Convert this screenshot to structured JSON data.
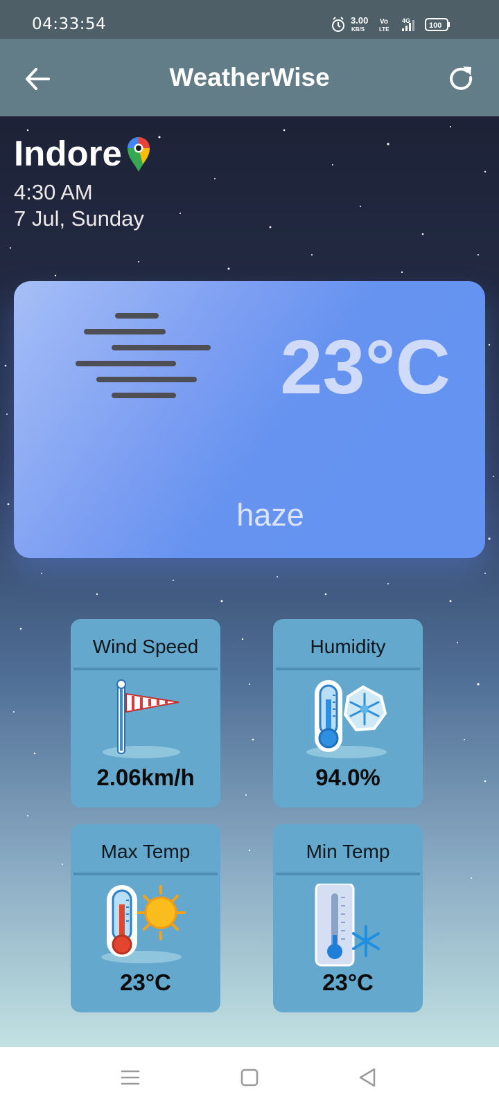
{
  "status_bar": {
    "time": "04:33:54",
    "net_speed_value": "3.00",
    "net_speed_unit": "KB/S",
    "volte_top": "Vo",
    "volte_bottom": "LTE",
    "network": "4G",
    "battery": "100",
    "icons": [
      "alarm-icon",
      "volte-icon",
      "signal-icon",
      "battery-icon"
    ]
  },
  "app_bar": {
    "title": "WeatherWise",
    "back_icon": "arrow-left-icon",
    "refresh_icon": "refresh-icon"
  },
  "location": {
    "city": "Indore",
    "pin_icon": "map-pin-icon",
    "time": "4:30 AM",
    "date": "7 Jul, Sunday"
  },
  "current": {
    "temperature": "23°C",
    "condition": "haze",
    "icon": "haze-icon"
  },
  "stats": [
    {
      "title": "Wind Speed",
      "value": "2.06km/h",
      "icon": "windsock-icon"
    },
    {
      "title": "Humidity",
      "value": "94.0%",
      "icon": "thermometer-snowflake-icon"
    },
    {
      "title": "Max Temp",
      "value": "23°C",
      "icon": "thermometer-sun-icon"
    },
    {
      "title": "Min Temp",
      "value": "23°C",
      "icon": "thermometer-cold-icon"
    }
  ],
  "nav_bar": {
    "icons": [
      "menu-icon",
      "home-square-icon",
      "back-triangle-icon"
    ]
  },
  "colors": {
    "status_bar": "#4e5f68",
    "app_bar": "#637d88",
    "card": "#6693f0",
    "tile": "#64a8cd"
  }
}
